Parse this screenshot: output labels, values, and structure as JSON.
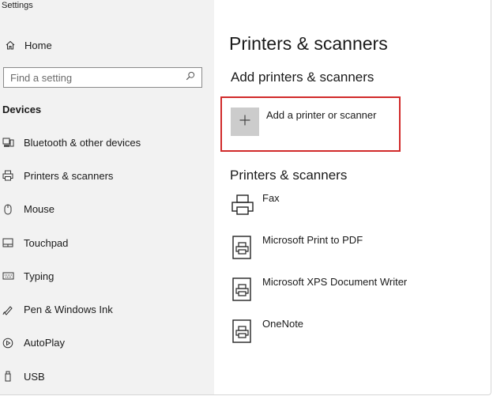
{
  "app": {
    "title": "Settings"
  },
  "sidebar": {
    "home_label": "Home",
    "search_placeholder": "Find a setting",
    "section_label": "Devices",
    "items": [
      {
        "label": "Bluetooth & other devices",
        "icon": "bluetooth-devices-icon"
      },
      {
        "label": "Printers & scanners",
        "icon": "printer-icon"
      },
      {
        "label": "Mouse",
        "icon": "mouse-icon"
      },
      {
        "label": "Touchpad",
        "icon": "touchpad-icon"
      },
      {
        "label": "Typing",
        "icon": "keyboard-icon"
      },
      {
        "label": "Pen & Windows Ink",
        "icon": "pen-icon"
      },
      {
        "label": "AutoPlay",
        "icon": "autoplay-icon"
      },
      {
        "label": "USB",
        "icon": "usb-icon"
      }
    ]
  },
  "main": {
    "title": "Printers & scanners",
    "add_section_title": "Add printers & scanners",
    "add_button_label": "Add a printer or scanner",
    "list_title": "Printers & scanners",
    "printers": [
      {
        "name": "Fax",
        "icon": "fax-icon"
      },
      {
        "name": "Microsoft Print to PDF",
        "icon": "document-printer-icon"
      },
      {
        "name": "Microsoft XPS Document Writer",
        "icon": "document-printer-icon"
      },
      {
        "name": "OneNote",
        "icon": "document-printer-icon"
      }
    ]
  },
  "colors": {
    "sidebar_bg": "#f2f2f2",
    "highlight_border": "#d12a2a",
    "plus_tile_bg": "#cccccc"
  }
}
